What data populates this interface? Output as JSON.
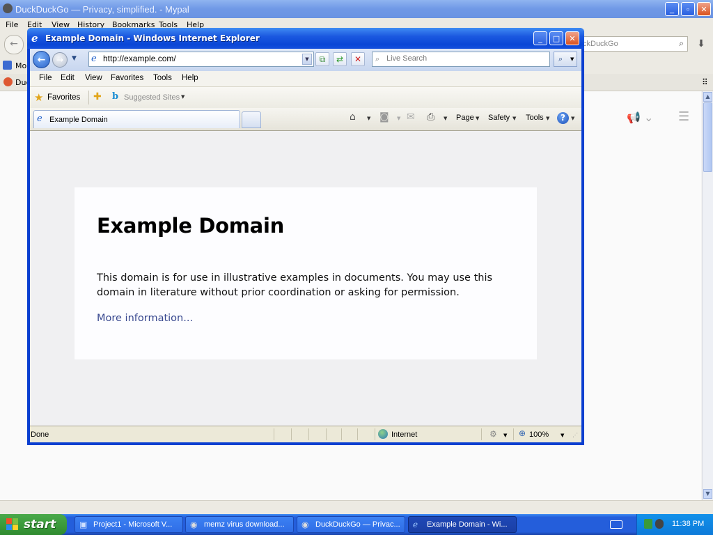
{
  "background_window": {
    "title": "DuckDuckGo — Privacy, simplified. - Mypal",
    "menu": [
      "File",
      "Edit",
      "View",
      "History",
      "Bookmarks",
      "Tools",
      "Help"
    ],
    "bookmark_partial": "Mo",
    "tab_partial": "Duc",
    "search_partial": "ckDuckGo"
  },
  "ie": {
    "title": "Example Domain - Windows Internet Explorer",
    "address": "http://example.com/",
    "search_placeholder": "Live Search",
    "menu": [
      "File",
      "Edit",
      "View",
      "Favorites",
      "Tools",
      "Help"
    ],
    "favorites_label": "Favorites",
    "suggested_sites": "Suggested Sites",
    "tab_label": "Example Domain",
    "commands": {
      "page": "Page",
      "safety": "Safety",
      "tools": "Tools"
    },
    "status_text": "Done",
    "zone": "Internet",
    "zoom": "100%"
  },
  "page": {
    "heading": "Example Domain",
    "paragraph": "This domain is for use in illustrative examples in documents. You may use this domain in literature without prior coordination or asking for permission.",
    "link": "More information..."
  },
  "taskbar": {
    "start": "start",
    "items": [
      {
        "label": "Project1 - Microsoft V...",
        "icon": "vb-icon"
      },
      {
        "label": "memz virus download...",
        "icon": "mypal-icon"
      },
      {
        "label": "DuckDuckGo — Privac...",
        "icon": "mypal-icon"
      },
      {
        "label": "Example Domain - Wi...",
        "icon": "ie-icon",
        "active": true
      }
    ],
    "clock": "11:38 PM"
  }
}
